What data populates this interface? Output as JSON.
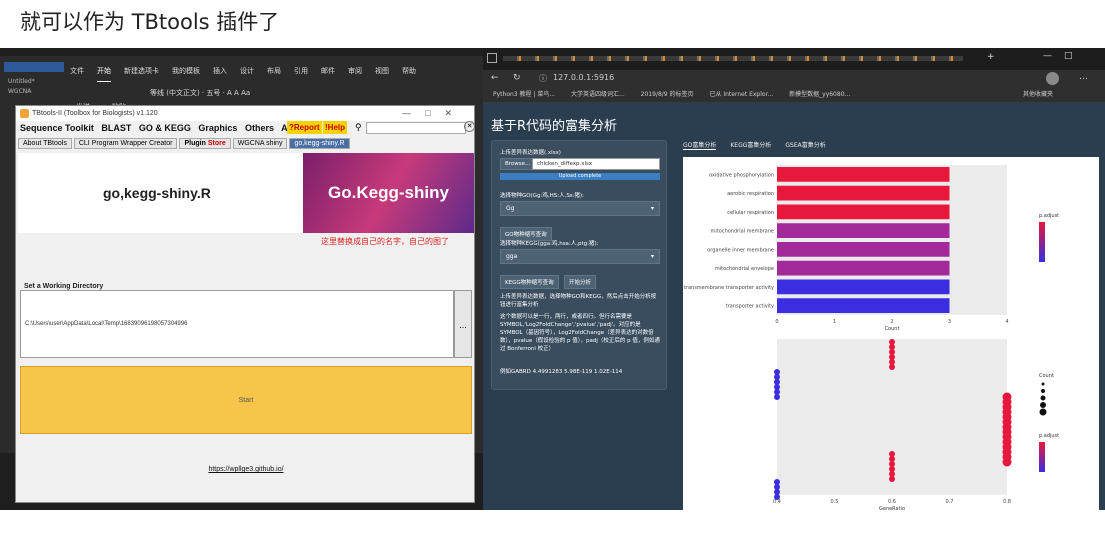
{
  "headline": "就可以作为 TBtools 插件了",
  "word": {
    "tabs": [
      "文件",
      "开始",
      "新建选项卡",
      "我的模板",
      "插入",
      "设计",
      "布局",
      "引用",
      "邮件",
      "审阅",
      "视图",
      "帮助"
    ],
    "active_tab": "开始",
    "font_row": "等线 (中文正文) · 五号 · A A Aa",
    "left_items": [
      "Untitled*",
      "WGCNA"
    ],
    "send_label": "发送",
    "paste_label": "粘贴"
  },
  "tbtools": {
    "title": "TBtools-II (Toolbox for Biologists) v1.120",
    "menu": [
      "Sequence Toolkit",
      "BLAST",
      "GO & KEGG",
      "Graphics",
      "Others",
      "About"
    ],
    "report": "?Report",
    "help": "!Help",
    "tabs": [
      "About TBtools",
      "CLI Program Wrapper Creator",
      "Plugin Store",
      "WGCNA shiny",
      "go,kegg-shiny.R"
    ],
    "plugin_word": "Plugin",
    "store_word": "Store",
    "plugin_title": "go,kegg-shiny.R",
    "logo_text": "Go.Kegg-shiny",
    "note": "这里替换成自己的名字，自己的图了",
    "working_dir_label": "Set a Working Directory",
    "working_dir": "C:\\Users\\user\\AppData\\Local\\Temp\\16839096198057304996",
    "dir_button": "...",
    "start": "Start",
    "link": "https://wpllge3.github.io/"
  },
  "browser": {
    "url": "127.0.0.1:5916",
    "bookmarks": [
      "Python3 教程 | 菜鸟...",
      "大学英语四级词汇...",
      "2019/8/9 的标签页",
      "已从 Internet Explor...",
      "新模型数据_yy6080...",
      "其他收藏夹"
    ],
    "page_title": "基于R代码的富集分析",
    "upload_label": "上传差异表达数据(.xlsx)",
    "browse": "Browse...",
    "file_name": "chicken_diffexp.xlsx",
    "upload_status": "Upload complete",
    "go_species_label": "选择物种GO(Gg:鸡,HS:人,Ss:猪):",
    "go_species_value": "Gg",
    "go_species_btn": "GO物种缩写查询",
    "kegg_species_label": "选择物种KEGG(gga:鸡,hsa:人,ptg:猪):",
    "kegg_species_value": "gga",
    "kegg_btn": "KEGG物种缩写查询",
    "start_btn": "开始分析",
    "desc1": "上传差异表达数据，选择物种GO和KEGG，然后点击开始分析按钮进行富集分析",
    "desc2": "这个数据可以是一行，两行，或者四行。但行名需要是SYMBOL,'Log2FoldChange','pvalue','padj'。对应的是SYMBOL（基因符号），Log2FoldChange（差异表达的对数倍数），pvalue（假设检验的 p 值），padj（校正后的 p 值，例如通过 Bonferroni 校正）",
    "example": "例如GABRD 4.4991283 5.98E-119 1.02E-114",
    "main_tabs": [
      "GO富集分析",
      "KEGG富集分析",
      "GSEA富集分析"
    ]
  },
  "chart_data": [
    {
      "type": "bar",
      "title": "",
      "xlabel": "Count",
      "ylabel": "",
      "categories": [
        "oxidative phosphorylation",
        "aerobic respiration",
        "cellular respiration",
        "mitochondrial membrane",
        "organelle inner membrane",
        "mitochondrial envelope",
        "proton transmembrane transporter activity",
        "transporter activity"
      ],
      "values": [
        3,
        3,
        3,
        3,
        3,
        3,
        3,
        3
      ],
      "xlim": [
        0,
        4
      ],
      "legend_title": "p.adjust",
      "bar_color_high": "#e8173c",
      "bar_color_low": "#3b2ee0"
    },
    {
      "type": "scatter",
      "title": "",
      "xlabel": "GeneRatio",
      "xlim": [
        0.4,
        0.8
      ],
      "x_ticks": [
        "0.4",
        "0.5",
        "0.6",
        "0.7",
        "0.8"
      ],
      "legend_titles": [
        "Count",
        "p.adjust"
      ],
      "point_color_high": "#e8173c",
      "point_color_low": "#3b2ee0"
    }
  ]
}
